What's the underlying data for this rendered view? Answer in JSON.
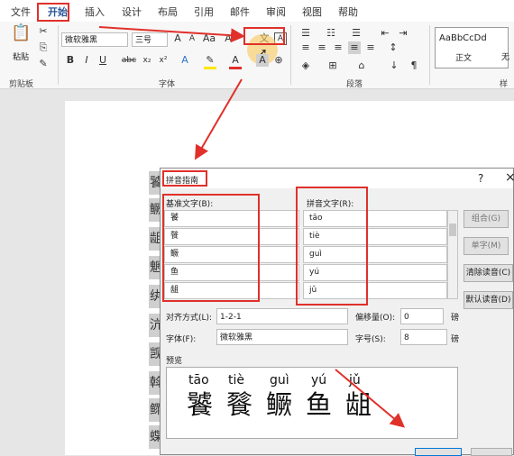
{
  "menu": {
    "tabs": [
      "文件",
      "开始",
      "插入",
      "设计",
      "布局",
      "引用",
      "邮件",
      "审阅",
      "视图",
      "帮助"
    ]
  },
  "ribbon": {
    "clipboard": {
      "paste_label": "粘贴",
      "group_label": "剪贴板"
    },
    "font": {
      "name": "微软雅黑",
      "size": "三号",
      "group_label": "字体",
      "buttons": [
        "A",
        "A",
        "Aa",
        "A",
        "B",
        "I",
        "U",
        "abc",
        "x₂",
        "x²",
        "A",
        "A",
        "A"
      ]
    },
    "paragraph": {
      "group_label": "段落"
    },
    "styles": {
      "normal_sample": "AaBbCcDd",
      "normal_label": "正文",
      "next_label": "无",
      "group_label": "样"
    }
  },
  "document": {
    "vertical_chars": [
      "饕",
      "鳜",
      "龃",
      "魍",
      "纨",
      "沆",
      "觊",
      "斡",
      "鳏",
      "蝶"
    ]
  },
  "dialog": {
    "title": "拼音指南",
    "help": "?",
    "close": "×",
    "base_label": "基准文字(B):",
    "ruby_label": "拼音文字(R):",
    "rows": [
      {
        "base": "饕",
        "ruby": "tāo"
      },
      {
        "base": "餮",
        "ruby": "tiè"
      },
      {
        "base": "鳜",
        "ruby": "guì"
      },
      {
        "base": "鱼",
        "ruby": "yú"
      },
      {
        "base": "龃",
        "ruby": "jǔ"
      }
    ],
    "buttons": {
      "group": "组合(G)",
      "single": "单字(M)",
      "clear": "清除读音(C)",
      "default": "默认读音(D)"
    },
    "align_label": "对齐方式(L):",
    "align_value": "1-2-1",
    "offset_label": "偏移量(O):",
    "offset_value": "0",
    "offset_unit": "磅",
    "font_label": "字体(F):",
    "font_value": "微软雅黑",
    "size_label": "字号(S):",
    "size_value": "8",
    "size_unit": "磅",
    "preview_label": "预览",
    "preview_pinyin": [
      "tāo",
      "tiè",
      "guì",
      "yú",
      "jǔ"
    ],
    "preview_chars": [
      "饕",
      "餮",
      "鳜",
      "鱼",
      "龃"
    ]
  },
  "colors": {
    "highlight": "#e0302a",
    "accent": "#2b579a"
  }
}
